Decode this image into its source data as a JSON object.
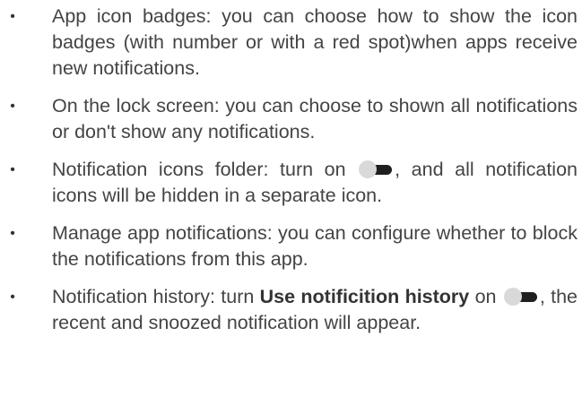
{
  "bullet_glyph": "•",
  "items": [
    {
      "text": "App icon badges: you can choose how to show the icon badges (with number or with a red spot)when apps receive new notifications."
    },
    {
      "text": "On the lock screen: you can choose to shown all notifications or don't show any notifications."
    },
    {
      "before": "Notification icons folder: turn on ",
      "toggle_icon": "toggle-switch-icon",
      "after": ", and all notification icons will be hidden in a separate icon."
    },
    {
      "text": "Manage app notifications: you can configure whether to block the notifications from this app."
    },
    {
      "before": "Notification history: turn ",
      "bold": "Use notificition history",
      "middle": " on ",
      "toggle_icon": "toggle-switch-icon",
      "after": ", the recent and snoozed notification will appear."
    }
  ],
  "colors": {
    "text": "#444444",
    "toggle_track": "#1f1f1f",
    "toggle_knob": "#d9d9d9"
  }
}
